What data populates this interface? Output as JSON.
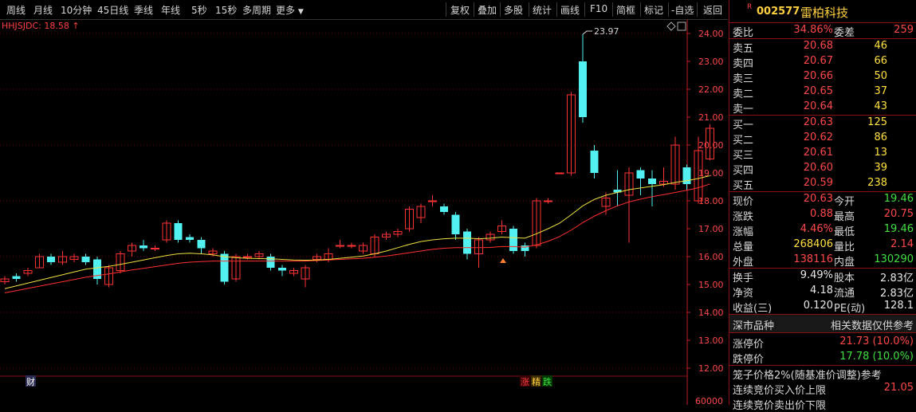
{
  "toolbar": {
    "left_items": [
      "周线",
      "月线",
      "10分钟",
      "45日线",
      "季线",
      "年线",
      "5秒",
      "15秒",
      "多周期",
      "更多"
    ],
    "right_items": [
      "复权",
      "叠加",
      "多股",
      "统计",
      "画线",
      "F10",
      "简框",
      "标记",
      "-自选",
      "返回"
    ]
  },
  "chart": {
    "indicator_label": "HHJSJDC: 18.58",
    "high_annotation": "23.97",
    "price_axis": [
      "24.00",
      "23.00",
      "22.00",
      "21.00",
      "20.00",
      "19.00",
      "18.00",
      "17.00",
      "16.00",
      "15.00",
      "14.00",
      "13.00",
      "12.00"
    ],
    "volume_axis_label": "60000",
    "event_marker_cai": "财",
    "event_marker_zhang": "涨",
    "event_marker_jing": "精",
    "event_marker_die": "跌",
    "colors": {
      "up": "#ff3232",
      "down": "#52f0f0",
      "ma_yellow": "#f0e040",
      "ma_red": "#ff3030",
      "grid": "#7a0000"
    }
  },
  "chart_data": {
    "type": "candlestick",
    "ylim": [
      11.7,
      24.6
    ],
    "candles": [
      {
        "o": 15.1,
        "c": 15.2,
        "h": 15.3,
        "l": 15.0
      },
      {
        "o": 15.3,
        "c": 15.2,
        "h": 15.4,
        "l": 15.1
      },
      {
        "o": 15.4,
        "c": 15.5,
        "h": 15.6,
        "l": 15.3
      },
      {
        "o": 15.6,
        "c": 16.0,
        "h": 16.1,
        "l": 15.6
      },
      {
        "o": 16.0,
        "c": 15.8,
        "h": 16.1,
        "l": 15.7
      },
      {
        "o": 15.8,
        "c": 16.0,
        "h": 16.2,
        "l": 15.7
      },
      {
        "o": 15.9,
        "c": 16.0,
        "h": 16.1,
        "l": 15.8
      },
      {
        "o": 16.0,
        "c": 15.8,
        "h": 16.1,
        "l": 15.7
      },
      {
        "o": 15.9,
        "c": 15.2,
        "h": 16.0,
        "l": 15.0
      },
      {
        "o": 15.0,
        "c": 15.6,
        "h": 15.7,
        "l": 14.9
      },
      {
        "o": 15.5,
        "c": 16.1,
        "h": 16.2,
        "l": 15.4
      },
      {
        "o": 16.2,
        "c": 16.4,
        "h": 16.5,
        "l": 16.0
      },
      {
        "o": 16.4,
        "c": 16.3,
        "h": 16.6,
        "l": 16.2
      },
      {
        "o": 16.3,
        "c": 16.3,
        "h": 16.4,
        "l": 16.2
      },
      {
        "o": 16.6,
        "c": 17.2,
        "h": 17.3,
        "l": 16.5
      },
      {
        "o": 17.2,
        "c": 16.6,
        "h": 17.3,
        "l": 16.5
      },
      {
        "o": 16.7,
        "c": 16.6,
        "h": 16.8,
        "l": 16.5
      },
      {
        "o": 16.6,
        "c": 16.3,
        "h": 16.7,
        "l": 16.1
      },
      {
        "o": 16.1,
        "c": 16.2,
        "h": 16.3,
        "l": 16.0
      },
      {
        "o": 16.1,
        "c": 15.1,
        "h": 16.2,
        "l": 15.0
      },
      {
        "o": 15.2,
        "c": 16.0,
        "h": 16.1,
        "l": 15.1
      },
      {
        "o": 16.0,
        "c": 16.0,
        "h": 16.1,
        "l": 15.9
      },
      {
        "o": 16.0,
        "c": 16.1,
        "h": 16.2,
        "l": 15.9
      },
      {
        "o": 16.0,
        "c": 15.6,
        "h": 16.1,
        "l": 15.5
      },
      {
        "o": 15.6,
        "c": 15.5,
        "h": 15.7,
        "l": 15.3
      },
      {
        "o": 15.4,
        "c": 15.5,
        "h": 15.6,
        "l": 15.3
      },
      {
        "o": 15.2,
        "c": 15.6,
        "h": 15.7,
        "l": 14.9
      },
      {
        "o": 15.9,
        "c": 16.0,
        "h": 16.1,
        "l": 15.8
      },
      {
        "o": 15.9,
        "c": 16.1,
        "h": 16.3,
        "l": 15.8
      },
      {
        "o": 16.4,
        "c": 16.4,
        "h": 16.6,
        "l": 16.3
      },
      {
        "o": 16.4,
        "c": 16.4,
        "h": 16.5,
        "l": 16.3
      },
      {
        "o": 16.2,
        "c": 16.4,
        "h": 16.5,
        "l": 16.1
      },
      {
        "o": 16.1,
        "c": 16.7,
        "h": 16.8,
        "l": 16.0
      },
      {
        "o": 16.7,
        "c": 16.8,
        "h": 16.9,
        "l": 16.6
      },
      {
        "o": 16.8,
        "c": 16.9,
        "h": 17.0,
        "l": 16.7
      },
      {
        "o": 17.0,
        "c": 17.7,
        "h": 17.8,
        "l": 16.9
      },
      {
        "o": 17.4,
        "c": 17.8,
        "h": 17.9,
        "l": 17.2
      },
      {
        "o": 18.0,
        "c": 18.0,
        "h": 18.2,
        "l": 17.8
      },
      {
        "o": 17.8,
        "c": 17.6,
        "h": 17.9,
        "l": 17.5
      },
      {
        "o": 17.5,
        "c": 16.8,
        "h": 17.6,
        "l": 16.6
      },
      {
        "o": 16.9,
        "c": 16.1,
        "h": 17.0,
        "l": 15.9
      },
      {
        "o": 16.1,
        "c": 16.6,
        "h": 16.7,
        "l": 15.6
      },
      {
        "o": 16.6,
        "c": 16.8,
        "h": 16.9,
        "l": 16.5
      },
      {
        "o": 16.9,
        "c": 17.1,
        "h": 17.3,
        "l": 16.8
      },
      {
        "o": 17.0,
        "c": 16.2,
        "h": 17.1,
        "l": 16.1
      },
      {
        "o": 16.4,
        "c": 16.2,
        "h": 16.5,
        "l": 16.0
      },
      {
        "o": 16.4,
        "c": 18.0,
        "h": 18.1,
        "l": 16.3
      },
      {
        "o": 18.0,
        "c": 18.0,
        "h": 18.1,
        "l": 17.9
      },
      {
        "o": 19.0,
        "c": 19.0,
        "h": 19.0,
        "l": 19.0
      },
      {
        "o": 19.0,
        "c": 21.8,
        "h": 21.9,
        "l": 18.9
      },
      {
        "o": 23.0,
        "c": 21.0,
        "h": 23.97,
        "l": 20.8
      },
      {
        "o": 19.8,
        "c": 19.0,
        "h": 20.0,
        "l": 18.8
      },
      {
        "o": 17.8,
        "c": 18.1,
        "h": 18.3,
        "l": 17.5
      },
      {
        "o": 18.4,
        "c": 18.3,
        "h": 19.1,
        "l": 17.8
      },
      {
        "o": 18.2,
        "c": 19.0,
        "h": 19.2,
        "l": 16.5
      },
      {
        "o": 19.1,
        "c": 18.8,
        "h": 19.2,
        "l": 18.2
      },
      {
        "o": 18.8,
        "c": 18.6,
        "h": 19.1,
        "l": 17.8
      },
      {
        "o": 18.6,
        "c": 18.7,
        "h": 19.2,
        "l": 18.5
      },
      {
        "o": 18.6,
        "c": 20.0,
        "h": 20.3,
        "l": 18.4
      },
      {
        "o": 19.2,
        "c": 18.6,
        "h": 19.3,
        "l": 18.4
      },
      {
        "o": 18.0,
        "c": 19.8,
        "h": 20.3,
        "l": 17.9
      },
      {
        "o": 19.5,
        "c": 20.6,
        "h": 20.75,
        "l": 19.46
      }
    ],
    "ma_yellow": [
      14.85,
      14.95,
      15.05,
      15.15,
      15.25,
      15.35,
      15.45,
      15.55,
      15.6,
      15.65,
      15.72,
      15.8,
      15.88,
      15.96,
      16.04,
      16.1,
      16.12,
      16.1,
      16.06,
      16.0,
      15.96,
      15.94,
      15.93,
      15.92,
      15.9,
      15.88,
      15.87,
      15.88,
      15.9,
      15.94,
      15.98,
      16.02,
      16.1,
      16.2,
      16.32,
      16.44,
      16.54,
      16.6,
      16.64,
      16.66,
      16.66,
      16.64,
      16.66,
      16.7,
      16.68,
      16.66,
      16.82,
      17.0,
      17.2,
      17.5,
      17.82,
      18.05,
      18.2,
      18.3,
      18.4,
      18.46,
      18.52,
      18.58,
      18.66,
      18.72,
      18.8,
      18.9
    ],
    "ma_red": [
      14.7,
      14.78,
      14.86,
      14.94,
      15.02,
      15.1,
      15.18,
      15.26,
      15.32,
      15.38,
      15.45,
      15.52,
      15.58,
      15.64,
      15.7,
      15.76,
      15.8,
      15.82,
      15.84,
      15.84,
      15.84,
      15.84,
      15.84,
      15.84,
      15.84,
      15.84,
      15.84,
      15.86,
      15.88,
      15.9,
      15.92,
      15.94,
      15.98,
      16.02,
      16.08,
      16.14,
      16.2,
      16.26,
      16.3,
      16.32,
      16.32,
      16.32,
      16.33,
      16.36,
      16.36,
      16.34,
      16.42,
      16.55,
      16.72,
      16.95,
      17.22,
      17.45,
      17.65,
      17.82,
      17.96,
      18.06,
      18.15,
      18.22,
      18.3,
      18.38,
      18.47,
      18.6
    ]
  },
  "quote": {
    "r_badge": "R",
    "code": "002577",
    "name": "雷柏科技",
    "wb_label": "委比",
    "wb_val": "34.86%",
    "wc_label": "委差",
    "wc_val": "259",
    "sells": [
      {
        "label": "卖五",
        "price": "20.68",
        "vol": "46"
      },
      {
        "label": "卖四",
        "price": "20.67",
        "vol": "66"
      },
      {
        "label": "卖三",
        "price": "20.66",
        "vol": "50"
      },
      {
        "label": "卖二",
        "price": "20.65",
        "vol": "37"
      },
      {
        "label": "卖一",
        "price": "20.64",
        "vol": "43"
      }
    ],
    "buys": [
      {
        "label": "买一",
        "price": "20.63",
        "vol": "125"
      },
      {
        "label": "买二",
        "price": "20.62",
        "vol": "86"
      },
      {
        "label": "买三",
        "price": "20.61",
        "vol": "13"
      },
      {
        "label": "买四",
        "price": "20.60",
        "vol": "39"
      },
      {
        "label": "买五",
        "price": "20.59",
        "vol": "238"
      }
    ],
    "stats": [
      {
        "l1": "现价",
        "v1": "20.63",
        "c1": "red",
        "l2": "今开",
        "v2": "19.46",
        "c2": "grn"
      },
      {
        "l1": "涨跌",
        "v1": "0.88",
        "c1": "red",
        "l2": "最高",
        "v2": "20.75",
        "c2": "red"
      },
      {
        "l1": "涨幅",
        "v1": "4.46%",
        "c1": "red",
        "l2": "最低",
        "v2": "19.46",
        "c2": "grn"
      },
      {
        "l1": "总量",
        "v1": "268406",
        "c1": "yel",
        "l2": "量比",
        "v2": "2.14",
        "c2": "red"
      },
      {
        "l1": "外盘",
        "v1": "138116",
        "c1": "red",
        "l2": "内盘",
        "v2": "130290",
        "c2": "grn"
      }
    ],
    "fund": [
      {
        "l1": "换手",
        "v1": "9.49%",
        "l2": "股本",
        "v2": "2.83亿"
      },
      {
        "l1": "净资",
        "v1": "4.18",
        "l2": "流通",
        "v2": "2.83亿"
      },
      {
        "l1": "收益(三)",
        "v1": "0.120",
        "l2": "PE(动)",
        "v2": "128.1"
      }
    ],
    "band_left": "深市品种",
    "band_right": "相关数据仅供参考",
    "limit_up_label": "涨停价",
    "limit_up_val": "21.73 (10.0%)",
    "limit_down_label": "跌停价",
    "limit_down_val": "17.78 (10.0%)",
    "cage_text": "笼子价格2%(随基准价调整)参考",
    "cont_buy_label": "连续竞价买入价上限",
    "cont_buy_val": "21.05",
    "cont_sell_label": "连续竞价卖出价下限"
  }
}
